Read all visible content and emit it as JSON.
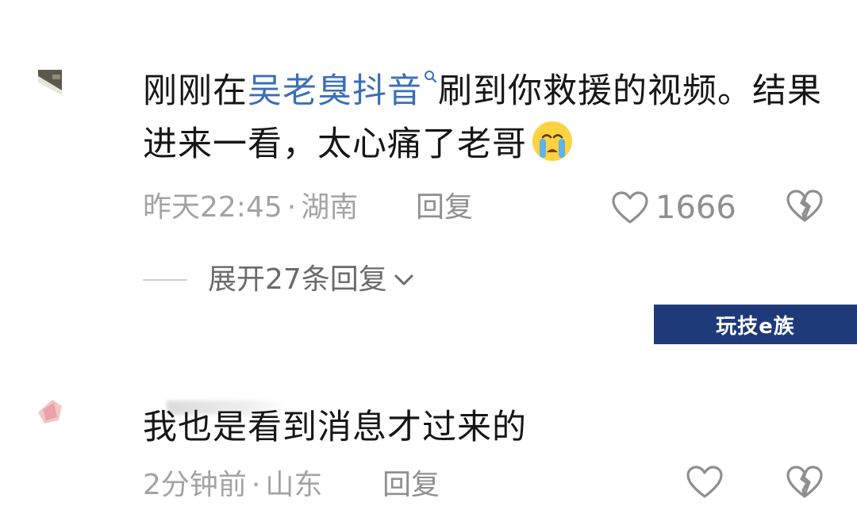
{
  "comments": [
    {
      "text_before": "刚刚在",
      "keyword": "吴老臭抖音",
      "text_after": "刷到你救援的视频。结果进来一看，太心痛了老哥",
      "emoji": "crying-face-emoji",
      "time": "昨天22:45",
      "separator": "·",
      "location": "湖南",
      "reply_label": "回复",
      "likes": "1666",
      "expand_label": "展开27条回复"
    },
    {
      "text": "我也是看到消息才过来的",
      "time": "2分钟前",
      "separator": "·",
      "location": "山东",
      "reply_label": "回复"
    }
  ],
  "watermark": "玩技e族",
  "colors": {
    "keyword": "#3b6fb6",
    "text": "#161616",
    "meta": "#a3a3a3",
    "watermark_bg": "#1e3a78"
  }
}
